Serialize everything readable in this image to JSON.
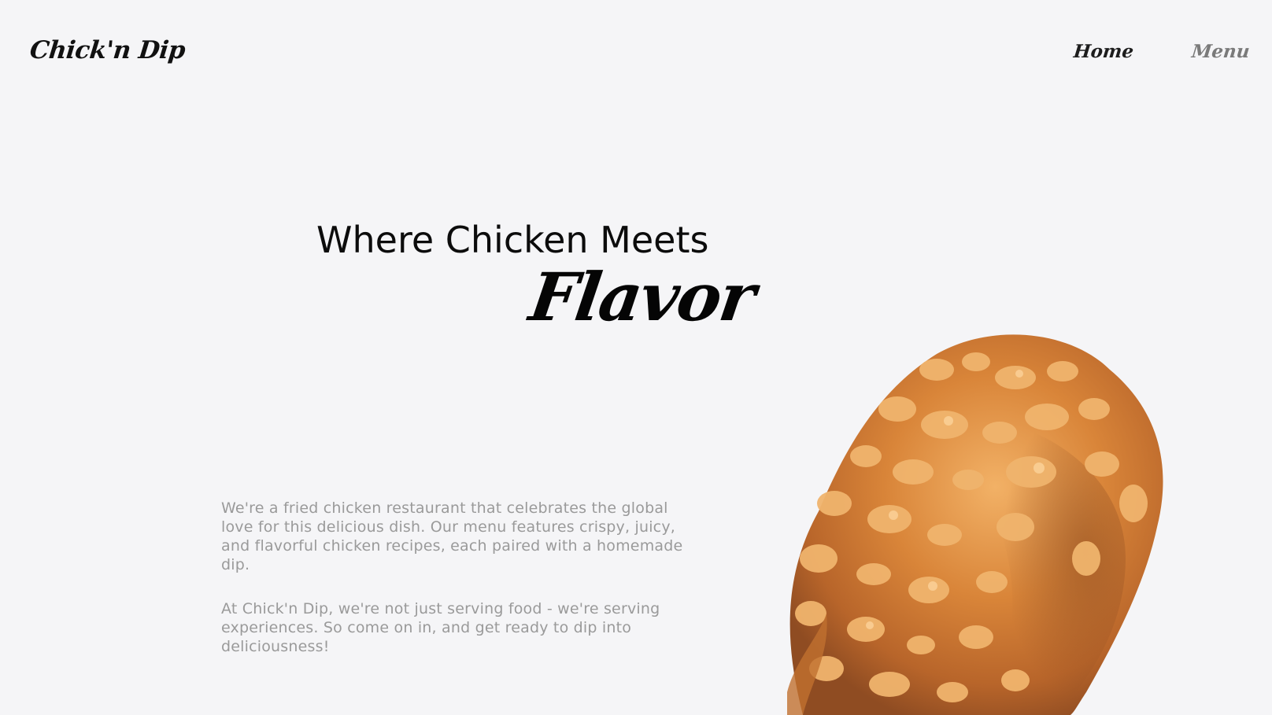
{
  "header": {
    "brand": "Chick'n Dip",
    "nav": [
      {
        "label": "Home"
      },
      {
        "label": "Menu"
      }
    ]
  },
  "hero": {
    "line1": "Where Chicken Meets",
    "line2": "Flavor"
  },
  "body": {
    "paragraph1": "We're a fried chicken restaurant that celebrates the global love for this delicious dish. Our menu features crispy, juicy, and flavorful chicken recipes, each paired with a homemade dip.",
    "paragraph2": "At Chick'n Dip, we're not just serving food - we're serving experiences. So come on in, and get ready to dip into deliciousness!"
  },
  "image": {
    "subject": "fried-chicken-drumstick"
  },
  "colors": {
    "background": "#f5f5f7",
    "heading": "#0c0c0c",
    "body_text": "#9a9a9a",
    "nav_active": "#1d1d1d",
    "nav_inactive": "#7a7a7a",
    "chicken_base": "#d9843c",
    "chicken_highlight": "#f0b36a"
  }
}
